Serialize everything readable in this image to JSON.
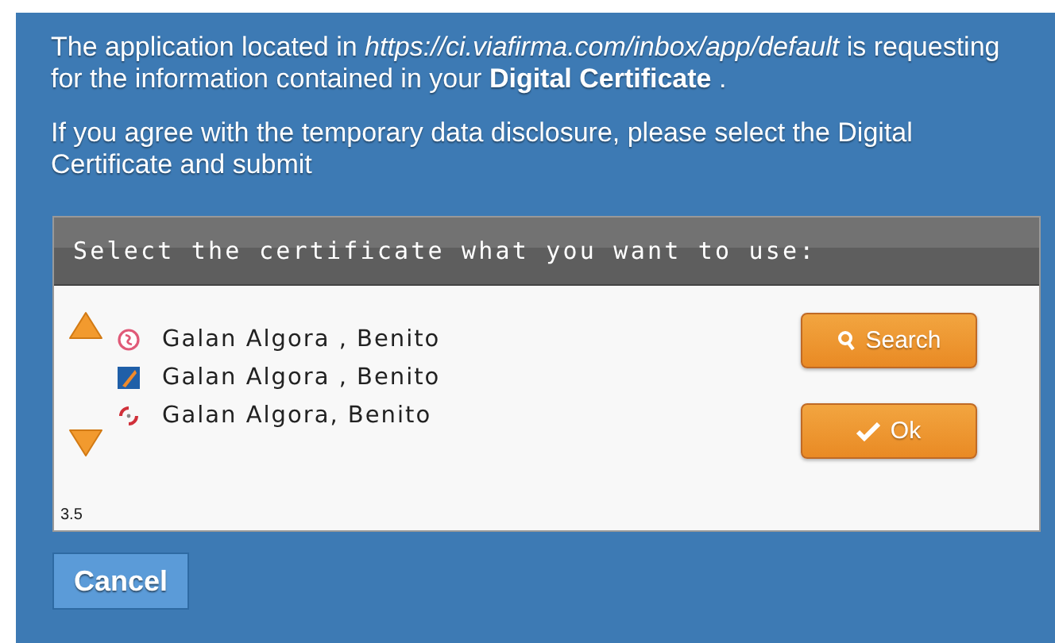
{
  "message": {
    "paragraphs": [
      "The application located in *https://ci.viafirma.com/inbox/app/default* is requesting for the information contained in your **Digital Certificate** .",
      "If you agree with the temporary data disclosure, please select the Digital Certificate and submit"
    ]
  },
  "applet": {
    "header": "Select the certificate what you want to use:",
    "certificates": [
      {
        "kind": "seal",
        "name": "Galan Algora , Benito"
      },
      {
        "kind": "stripe",
        "name": "Galan Algora , Benito"
      },
      {
        "kind": "ring",
        "name": "Galan Algora, Benito"
      }
    ],
    "buttons": [
      {
        "kind": "search",
        "label": "Search"
      },
      {
        "kind": "ok",
        "label": "Ok"
      }
    ],
    "version": "3.5"
  },
  "cancel_button": "Cancel"
}
